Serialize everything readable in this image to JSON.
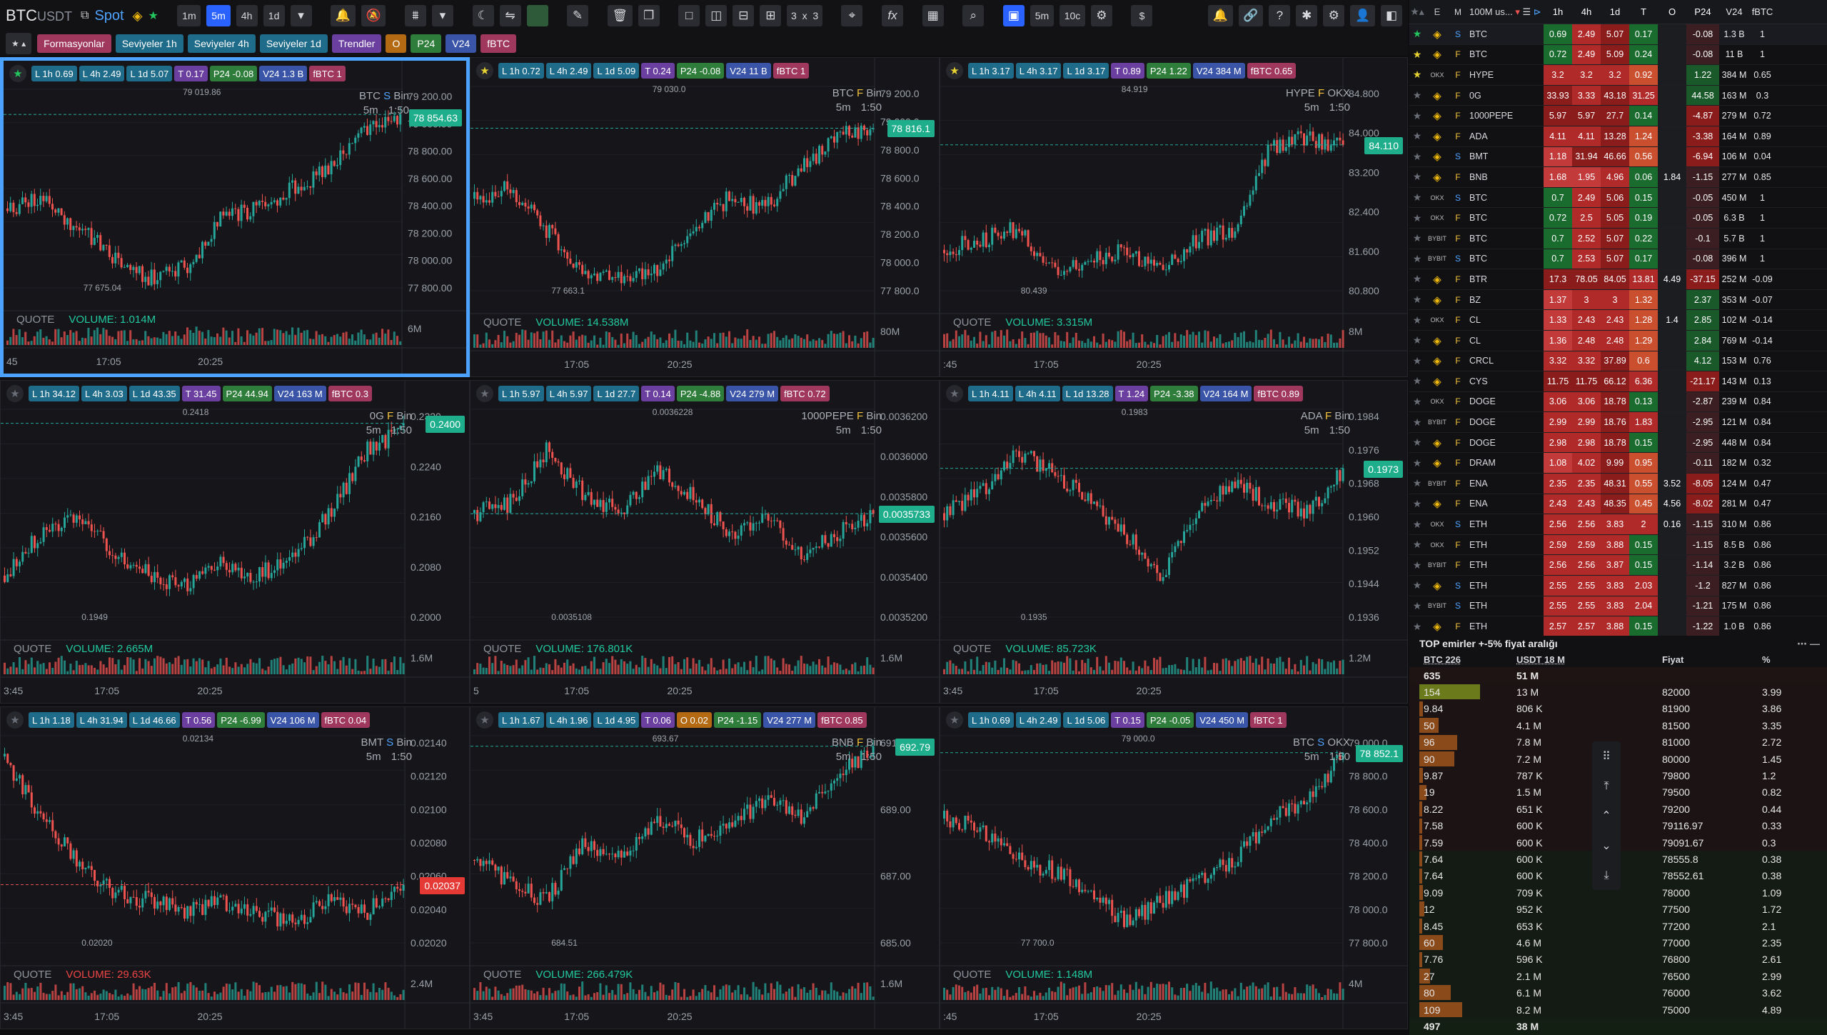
{
  "toolbar": {
    "symbol": "BTC",
    "quote": "USDT",
    "market": "Spot",
    "timeframes": [
      "1m",
      "5m",
      "4h",
      "1d"
    ],
    "active_tf": "5m",
    "grid_rows": "3",
    "grid_x": "x",
    "grid_cols": "3",
    "tf_small": "5m",
    "count": "10c",
    "currency": "$",
    "icons": [
      "copy-icon",
      "binance-icon",
      "star-icon",
      "dropdown-icon",
      "alarm-icon",
      "alarm-off-icon",
      "settings-icon",
      "swap-icon",
      "ruler-icon",
      "lock-icon",
      "trash-icon",
      "layout-icon",
      "function-icon",
      "table-icon",
      "search-icon",
      "bell-icon",
      "link-icon",
      "help-icon",
      "bug-icon",
      "user-icon"
    ]
  },
  "chips": [
    {
      "label": "Formasyonlar",
      "color": "#a0385e"
    },
    {
      "label": "Seviyeler 1h",
      "color": "#1f6b8a"
    },
    {
      "label": "Seviyeler 4h",
      "color": "#1f6b8a"
    },
    {
      "label": "Seviyeler 1d",
      "color": "#1f6b8a"
    },
    {
      "label": "Trendler",
      "color": "#6b3fa0"
    },
    {
      "label": "O",
      "color": "#b36a12"
    },
    {
      "label": "P24",
      "color": "#2f7d3a"
    },
    {
      "label": "V24",
      "color": "#3a55a8"
    },
    {
      "label": "fBTC",
      "color": "#a0385e"
    }
  ],
  "panels": [
    {
      "symbol": "BTC",
      "type": "S",
      "exch": "Bin",
      "tf": "5m",
      "ratio": "1:50",
      "badges": {
        "l1h": "L 1h 0.69",
        "l4h": "L 4h 2.49",
        "l1d": "L 1d 5.07",
        "t": "T 0.17",
        "p": "P24 -0.08",
        "v": "V24 1.3 B",
        "r": "fBTC 1"
      },
      "yticks": [
        "79 200.00",
        "79 000.00",
        "78 800.00",
        "78 600.00",
        "78 400.00",
        "78 200.00",
        "78 000.00",
        "77 800.00"
      ],
      "last": "78 854.63",
      "hi": "79 019.86",
      "lo": "77 675.04",
      "quote": "QUOTE",
      "vol": "VOLUME: 1.014M",
      "volaxis": "6M",
      "times": [
        "45",
        "17:05",
        "20:25"
      ],
      "star": "on"
    },
    {
      "symbol": "BTC",
      "type": "F",
      "exch": "Bin",
      "tf": "5m",
      "ratio": "1:50",
      "badges": {
        "l1h": "L 1h 0.72",
        "l4h": "L 4h 2.49",
        "l1d": "L 1d 5.09",
        "t": "T 0.24",
        "p": "P24 -0.08",
        "v": "V24 11 B",
        "r": "fBTC 1"
      },
      "yticks": [
        "79 200.0",
        "79 000.0",
        "78 800.0",
        "78 600.0",
        "78 400.0",
        "78 200.0",
        "78 000.0",
        "77 800.0"
      ],
      "last": "78 816.1",
      "hi": "79 030.0",
      "lo": "77 663.1",
      "quote": "QUOTE",
      "vol": "VOLUME: 14.538M",
      "volaxis": "80M",
      "times": [
        "",
        "17:05",
        "20:25"
      ],
      "star": "y"
    },
    {
      "symbol": "HYPE",
      "type": "F",
      "exch": "OKX",
      "tf": "5m",
      "ratio": "1:50",
      "badges": {
        "l1h": "L 1h 3.17",
        "l4h": "L 4h 3.17",
        "l1d": "L 1d 3.17",
        "t": "T 0.89",
        "p": "P24 1.22",
        "v": "V24 384 M",
        "r": "fBTC 0.65"
      },
      "yticks": [
        "84.800",
        "84.000",
        "83.200",
        "82.400",
        "81.600",
        "80.800"
      ],
      "last": "84.110",
      "hi": "84.919",
      "lo": "80.439",
      "quote": "QUOTE",
      "vol": "VOLUME: 3.315M",
      "volaxis": "8M",
      "times": [
        ":45",
        "17:05",
        "20:25"
      ],
      "star": "y"
    },
    {
      "symbol": "0G",
      "type": "F",
      "exch": "Bin",
      "tf": "5m",
      "ratio": "1:50",
      "badges": {
        "l1h": "L 1h 34.12",
        "l4h": "L 4h 3.03",
        "l1d": "L 1d 43.35",
        "t": "T 31.45",
        "p": "P24 44.94",
        "v": "V24 163 M",
        "r": "fBTC 0.3"
      },
      "yticks": [
        "0.2320",
        "0.2240",
        "0.2160",
        "0.2080",
        "0.2000"
      ],
      "last": "0.2400",
      "hi": "0.2418",
      "lo": "0.1949",
      "quote": "QUOTE",
      "vol": "VOLUME: 2.665M",
      "volaxis": "1.6M",
      "times": [
        "3:45",
        "17:05",
        "20:25"
      ],
      "star": "off"
    },
    {
      "symbol": "1000PEPE",
      "type": "F",
      "exch": "Bin",
      "tf": "5m",
      "ratio": "1:50",
      "badges": {
        "l1h": "L 1h 5.97",
        "l4h": "L 4h 5.97",
        "l1d": "L 1d 27.7",
        "t": "T 0.14",
        "p": "P24 -4.88",
        "v": "V24 279 M",
        "r": "fBTC 0.72"
      },
      "yticks": [
        "0.0036200",
        "0.0036000",
        "0.0035800",
        "0.0035600",
        "0.0035400",
        "0.0035200"
      ],
      "last": "0.0035733",
      "hi": "0.0036228",
      "lo": "0.0035108",
      "quote": "QUOTE",
      "vol": "VOLUME: 176.801K",
      "volaxis": "1.6M",
      "times": [
        "5",
        "17:05",
        "20:25"
      ],
      "star": "off"
    },
    {
      "symbol": "ADA",
      "type": "F",
      "exch": "Bin",
      "tf": "5m",
      "ratio": "1:50",
      "badges": {
        "l1h": "L 1h 4.11",
        "l4h": "L 4h 4.11",
        "l1d": "L 1d 13.28",
        "t": "T 1.24",
        "p": "P24 -3.38",
        "v": "V24 164 M",
        "r": "fBTC 0.89"
      },
      "yticks": [
        "0.1984",
        "0.1976",
        "0.1968",
        "0.1960",
        "0.1952",
        "0.1944",
        "0.1936"
      ],
      "last": "0.1973",
      "hi": "0.1983",
      "lo": "0.1935",
      "quote": "QUOTE",
      "vol": "VOLUME: 85.723K",
      "volaxis": "1.2M",
      "times": [
        "3:45",
        "17:05",
        "20:25"
      ],
      "star": "off"
    },
    {
      "symbol": "BMT",
      "type": "S",
      "exch": "Bin",
      "tf": "5m",
      "ratio": "1:50",
      "badges": {
        "l1h": "L 1h 1.18",
        "l4h": "L 4h 31.94",
        "l1d": "L 1d 46.66",
        "t": "T 0.56",
        "p": "P24 -6.99",
        "v": "V24 106 M",
        "r": "fBTC 0.04"
      },
      "yticks": [
        "0.02140",
        "0.02120",
        "0.02100",
        "0.02080",
        "0.02060",
        "0.02040",
        "0.02020"
      ],
      "last": "0.02037",
      "hi": "0.02134",
      "lo": "0.02020",
      "quote": "QUOTE",
      "vol": "VOLUME: 29.63K",
      "volaxis": "2.4M",
      "times": [
        "3:45",
        "17:05",
        "20:25"
      ],
      "star": "off"
    },
    {
      "symbol": "BNB",
      "type": "F",
      "exch": "Bin",
      "tf": "5m",
      "ratio": "1:50",
      "badges": {
        "l1h": "L 1h 1.67",
        "l4h": "L 4h 1.96",
        "l1d": "L 1d 4.95",
        "t": "T 0.06",
        "o": "O 0.02",
        "p": "P24 -1.15",
        "v": "V24 277 M",
        "r": "fBTC 0.85"
      },
      "yticks": [
        "691.00",
        "689.00",
        "687.00",
        "685.00"
      ],
      "last": "692.79",
      "hi": "693.67",
      "lo": "684.51",
      "quote": "QUOTE",
      "vol": "VOLUME: 266.479K",
      "volaxis": "1.6M",
      "times": [
        "3:45",
        "17:05",
        "20:25"
      ],
      "star": "off"
    },
    {
      "symbol": "BTC",
      "type": "S",
      "exch": "OKX",
      "tf": "5m",
      "ratio": "1:50",
      "badges": {
        "l1h": "L 1h 0.69",
        "l4h": "L 4h 2.49",
        "l1d": "L 1d 5.06",
        "t": "T 0.15",
        "p": "P24 -0.05",
        "v": "V24 450 M",
        "r": "fBTC 1"
      },
      "yticks": [
        "79 000.0",
        "78 800.0",
        "78 600.0",
        "78 400.0",
        "78 200.0",
        "78 000.0",
        "77 800.0"
      ],
      "last": "78 852.1",
      "hi": "79 000.0",
      "lo": "77 700.0",
      "quote": "QUOTE",
      "vol": "VOLUME: 1.148M",
      "volaxis": "4M",
      "times": [
        ":45",
        "17:05",
        "20:25"
      ],
      "star": "off"
    }
  ],
  "market": {
    "header": [
      "E",
      "M",
      "100M us...",
      "1h",
      "4h",
      "1d",
      "T",
      "O",
      "P24",
      "V24",
      "fBTC"
    ],
    "rows": [
      [
        "g",
        "binance",
        "S",
        "BTC",
        "0.69",
        "2.49",
        "5.07",
        "0.17",
        "",
        "-0.08",
        "1.3 B",
        "1"
      ],
      [
        "y",
        "binance",
        "F",
        "BTC",
        "0.72",
        "2.49",
        "5.09",
        "0.24",
        "",
        "-0.08",
        "11 B",
        "1"
      ],
      [
        "y",
        "OKX",
        "F",
        "HYPE",
        "3.2",
        "3.2",
        "3.2",
        "0.92",
        "",
        "1.22",
        "384 M",
        "0.65"
      ],
      [
        "",
        "binance",
        "F",
        "0G",
        "33.93",
        "3.33",
        "43.18",
        "31.25",
        "",
        "44.58",
        "163 M",
        "0.3"
      ],
      [
        "",
        "binance",
        "F",
        "1000PEPE",
        "5.97",
        "5.97",
        "27.7",
        "0.14",
        "",
        "-4.87",
        "279 M",
        "0.72"
      ],
      [
        "",
        "binance",
        "F",
        "ADA",
        "4.11",
        "4.11",
        "13.28",
        "1.24",
        "",
        "-3.38",
        "164 M",
        "0.89"
      ],
      [
        "",
        "binance",
        "S",
        "BMT",
        "1.18",
        "31.94",
        "46.66",
        "0.56",
        "",
        "-6.94",
        "106 M",
        "0.04"
      ],
      [
        "",
        "binance",
        "F",
        "BNB",
        "1.68",
        "1.95",
        "4.96",
        "0.06",
        "1.84",
        "-1.15",
        "277 M",
        "0.85"
      ],
      [
        "",
        "OKX",
        "S",
        "BTC",
        "0.7",
        "2.49",
        "5.06",
        "0.15",
        "",
        "-0.05",
        "450 M",
        "1"
      ],
      [
        "",
        "OKX",
        "F",
        "BTC",
        "0.72",
        "2.5",
        "5.05",
        "0.19",
        "",
        "-0.05",
        "6.3 B",
        "1"
      ],
      [
        "",
        "BYBIT",
        "F",
        "BTC",
        "0.7",
        "2.52",
        "5.07",
        "0.22",
        "",
        "-0.1",
        "5.7 B",
        "1"
      ],
      [
        "",
        "BYBIT",
        "S",
        "BTC",
        "0.7",
        "2.53",
        "5.07",
        "0.17",
        "",
        "-0.08",
        "396 M",
        "1"
      ],
      [
        "",
        "binance",
        "F",
        "BTR",
        "17.3",
        "78.05",
        "84.05",
        "13.81",
        "4.49",
        "-37.15",
        "252 M",
        "-0.09"
      ],
      [
        "",
        "binance",
        "F",
        "BZ",
        "1.37",
        "3",
        "3",
        "1.32",
        "",
        "2.37",
        "353 M",
        "-0.07"
      ],
      [
        "",
        "OKX",
        "F",
        "CL",
        "1.33",
        "2.43",
        "2.43",
        "1.28",
        "1.4",
        "2.85",
        "102 M",
        "-0.14"
      ],
      [
        "",
        "binance",
        "F",
        "CL",
        "1.36",
        "2.48",
        "2.48",
        "1.29",
        "",
        "2.84",
        "769 M",
        "-0.14"
      ],
      [
        "",
        "binance",
        "F",
        "CRCL",
        "3.32",
        "3.32",
        "37.89",
        "0.6",
        "",
        "4.12",
        "153 M",
        "0.76"
      ],
      [
        "",
        "binance",
        "F",
        "CYS",
        "11.75",
        "11.75",
        "66.12",
        "6.36",
        "",
        "-21.17",
        "143 M",
        "0.13"
      ],
      [
        "",
        "OKX",
        "F",
        "DOGE",
        "3.06",
        "3.06",
        "18.78",
        "0.13",
        "",
        "-2.87",
        "239 M",
        "0.84"
      ],
      [
        "",
        "BYBIT",
        "F",
        "DOGE",
        "2.99",
        "2.99",
        "18.76",
        "1.83",
        "",
        "-2.95",
        "121 M",
        "0.84"
      ],
      [
        "",
        "binance",
        "F",
        "DOGE",
        "2.98",
        "2.98",
        "18.78",
        "0.15",
        "",
        "-2.95",
        "448 M",
        "0.84"
      ],
      [
        "",
        "binance",
        "F",
        "DRAM",
        "1.08",
        "4.02",
        "9.99",
        "0.95",
        "",
        "-0.11",
        "182 M",
        "0.32"
      ],
      [
        "",
        "BYBIT",
        "F",
        "ENA",
        "2.35",
        "2.35",
        "48.31",
        "0.55",
        "3.52",
        "-8.05",
        "124 M",
        "0.47"
      ],
      [
        "",
        "binance",
        "F",
        "ENA",
        "2.43",
        "2.43",
        "48.35",
        "0.45",
        "4.56",
        "-8.02",
        "281 M",
        "0.47"
      ],
      [
        "",
        "OKX",
        "S",
        "ETH",
        "2.56",
        "2.56",
        "3.83",
        "2",
        "0.16",
        "-1.15",
        "310 M",
        "0.86"
      ],
      [
        "",
        "OKX",
        "F",
        "ETH",
        "2.59",
        "2.59",
        "3.88",
        "0.15",
        "",
        "-1.15",
        "8.5 B",
        "0.86"
      ],
      [
        "",
        "BYBIT",
        "F",
        "ETH",
        "2.56",
        "2.56",
        "3.87",
        "0.15",
        "",
        "-1.14",
        "3.2 B",
        "0.86"
      ],
      [
        "",
        "binance",
        "S",
        "ETH",
        "2.55",
        "2.55",
        "3.83",
        "2.03",
        "",
        "-1.2",
        "827 M",
        "0.86"
      ],
      [
        "",
        "BYBIT",
        "S",
        "ETH",
        "2.55",
        "2.55",
        "3.83",
        "2.04",
        "",
        "-1.21",
        "175 M",
        "0.86"
      ],
      [
        "",
        "binance",
        "F",
        "ETH",
        "2.57",
        "2.57",
        "3.88",
        "0.15",
        "",
        "-1.22",
        "1.0 B",
        "0.86"
      ]
    ]
  },
  "orderbook": {
    "title": "TOP emirler +-5% fiyat aralığı",
    "col1": "BTC 226",
    "col2": "USDT 18 M",
    "col3": "Fiyat",
    "col4": "%",
    "top_btc": "635",
    "top_usdt": "51 M",
    "rows": [
      [
        "154",
        "13 M",
        "82000",
        "3.99",
        1.0,
        "#6b7a1a"
      ],
      [
        "9.84",
        "806 K",
        "81900",
        "3.86",
        0.06,
        "#8a4a1a"
      ],
      [
        "50",
        "4.1 M",
        "81500",
        "3.35",
        0.32,
        "#8a4a1a"
      ],
      [
        "96",
        "7.8 M",
        "81000",
        "2.72",
        0.62,
        "#8a4a1a"
      ],
      [
        "90",
        "7.2 M",
        "80000",
        "1.45",
        0.58,
        "#8a4a1a"
      ],
      [
        "9.87",
        "787 K",
        "79800",
        "1.2",
        0.06,
        "#8a4a1a"
      ],
      [
        "19",
        "1.5 M",
        "79500",
        "0.82",
        0.12,
        "#8a4a1a"
      ],
      [
        "8.22",
        "651 K",
        "79200",
        "0.44",
        0.05,
        "#8a4a1a"
      ],
      [
        "7.58",
        "600 K",
        "79116.97",
        "0.33",
        0.05,
        "#8a4a1a"
      ],
      [
        "7.59",
        "600 K",
        "79091.67",
        "0.3",
        0.05,
        "#8a4a1a"
      ],
      [
        "7.64",
        "600 K",
        "78555.8",
        "0.38",
        0.05,
        "#8a4a1a"
      ],
      [
        "7.64",
        "600 K",
        "78552.61",
        "0.38",
        0.05,
        "#8a4a1a"
      ],
      [
        "9.09",
        "709 K",
        "78000",
        "1.09",
        0.06,
        "#8a4a1a"
      ],
      [
        "12",
        "952 K",
        "77500",
        "1.72",
        0.08,
        "#8a4a1a"
      ],
      [
        "8.45",
        "653 K",
        "77200",
        "2.1",
        0.05,
        "#8a4a1a"
      ],
      [
        "60",
        "4.6 M",
        "77000",
        "2.35",
        0.39,
        "#8a4a1a"
      ],
      [
        "7.76",
        "596 K",
        "76800",
        "2.61",
        0.05,
        "#8a4a1a"
      ],
      [
        "27",
        "2.1 M",
        "76500",
        "2.99",
        0.18,
        "#8a4a1a"
      ],
      [
        "80",
        "6.1 M",
        "76000",
        "3.62",
        0.52,
        "#8a4a1a"
      ],
      [
        "109",
        "8.2 M",
        "75000",
        "4.89",
        0.71,
        "#8a4a1a"
      ]
    ],
    "bottom_btc": "497",
    "bottom_usdt": "38 M"
  },
  "colors": {
    "up": "#26a69a",
    "down": "#ef5350",
    "accent": "#2962ff",
    "select": "#4ba3ff"
  }
}
